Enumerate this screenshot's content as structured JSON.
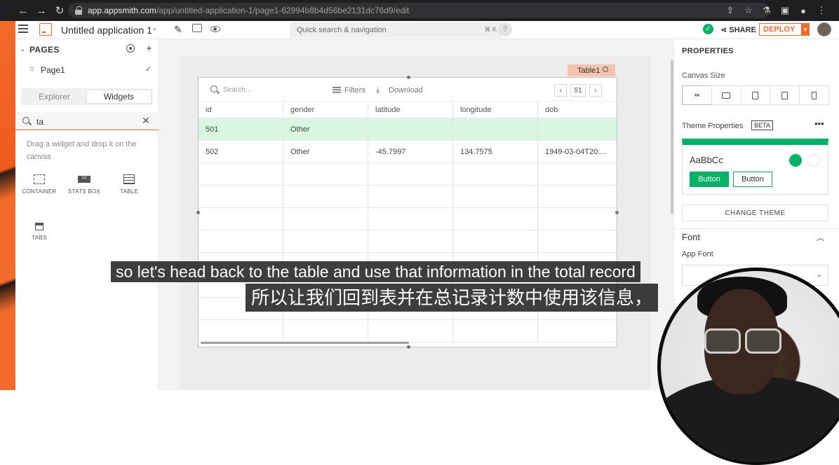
{
  "browser": {
    "url_host": "app.appsmith.com",
    "url_path": "/app/untitled-application-1/page1-62994b8b4d56be2131dc76d9/edit"
  },
  "header": {
    "app_name": "Untitled application 1",
    "search_placeholder": "Quick search & navigation",
    "search_shortcut": "⌘ K",
    "help_label": "?",
    "share_label": "SHARE",
    "deploy_label": "DEPLOY"
  },
  "sidebar": {
    "pages_title": "PAGES",
    "page_name": "Page1",
    "tabs": [
      "Explorer",
      "Widgets"
    ],
    "active_tab": "Widgets",
    "search_value": "ta",
    "drag_hint": "Drag a widget and drop it on the canvas",
    "widgets": [
      {
        "label": "CONTAINER",
        "icon": "container-icon"
      },
      {
        "label": "STATS BOX",
        "icon": "stats-box-icon",
        "badge": "12"
      },
      {
        "label": "TABLE",
        "icon": "table-icon"
      },
      {
        "label": "TABS",
        "icon": "tabs-icon"
      }
    ]
  },
  "canvas": {
    "table_tag": "Table1",
    "table": {
      "search_placeholder": "Search...",
      "filters_label": "Filters",
      "download_label": "Download",
      "page_number": "51",
      "columns": [
        "id",
        "gender",
        "latitude",
        "longitude",
        "dob"
      ],
      "rows": [
        [
          "501",
          "Other",
          "",
          "",
          ""
        ],
        [
          "502",
          "Other",
          "-45.7997",
          "134.7575",
          "1949-03-04T20:..."
        ],
        [
          "",
          "",
          "",
          "",
          ""
        ],
        [
          "",
          "",
          "",
          "",
          ""
        ],
        [
          "",
          "",
          "",
          "",
          ""
        ],
        [
          "",
          "",
          "",
          "",
          ""
        ],
        [
          "",
          "",
          "",
          "",
          ""
        ],
        [
          "",
          "",
          "",
          "",
          ""
        ],
        [
          "",
          "",
          "",
          "",
          ""
        ],
        [
          "",
          "",
          "",
          "",
          ""
        ]
      ],
      "selected_row_index": 0
    }
  },
  "properties": {
    "title": "PROPERTIES",
    "canvas_size_label": "Canvas Size",
    "devices": [
      "fluid-width-icon",
      "desktop-icon",
      "tablet-icon",
      "tablet-portrait-icon",
      "mobile-icon"
    ],
    "theme_label": "Theme Properties",
    "beta_badge": "BETA",
    "theme_more": "•••",
    "theme_sample": "AaBbCc",
    "theme_primary_color": "#03b365",
    "theme_button_primary": "Button",
    "theme_button_secondary": "Button",
    "change_theme": "CHANGE THEME",
    "font_title": "Font",
    "app_font_label": "App Font"
  },
  "subtitles": {
    "english": "so let's head back to the table and use that information in the total record",
    "chinese": "所以让我们回到表并在总记录计数中使用该信息，"
  },
  "colors": {
    "brand_orange": "#f86a2b",
    "success_green": "#03b365",
    "selected_row": "#d9f6e3"
  }
}
